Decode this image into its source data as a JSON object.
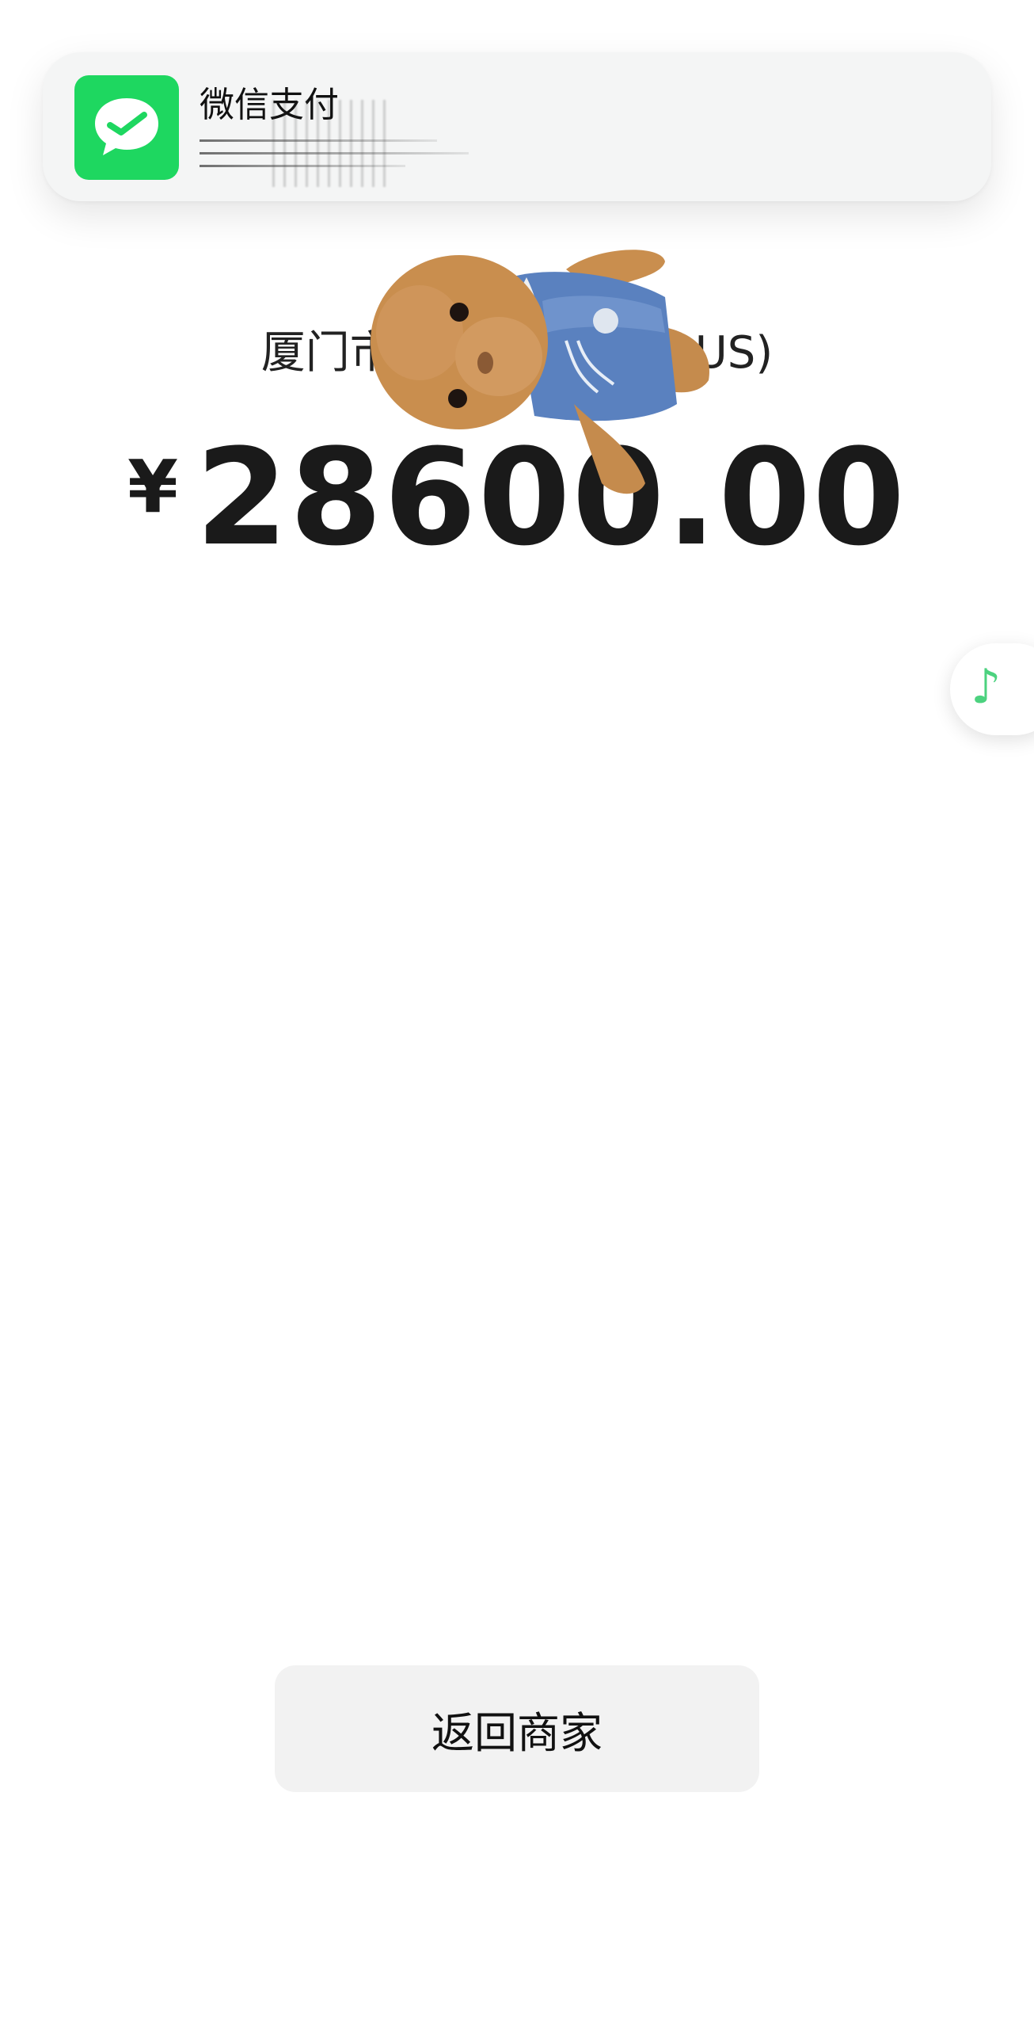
{
  "notification": {
    "app_name": "微信支付",
    "icon": "wechat-pay-icon",
    "accent_color": "#1ed760"
  },
  "payment": {
    "merchant": "厦门市",
    "merchant_tail": "US)",
    "currency_symbol": "¥",
    "amount": "28600.00"
  },
  "floating": {
    "icon": "music-note-icon",
    "glyph": "♪",
    "color": "#4cd27f"
  },
  "actions": {
    "return_label": "返回商家"
  }
}
